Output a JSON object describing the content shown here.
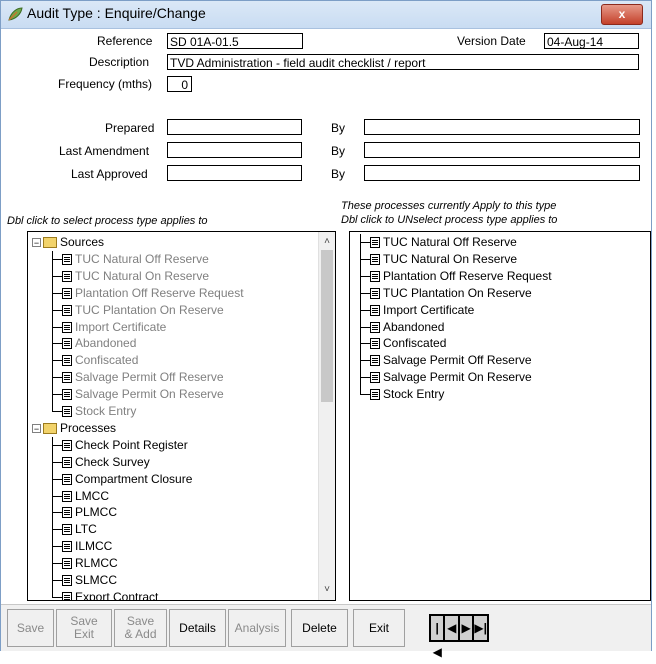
{
  "window": {
    "title": "Audit Type : Enquire/Change",
    "close_label": "x"
  },
  "form": {
    "reference_label": "Reference",
    "reference_value": "SD 01A-01.5",
    "version_date_label": "Version Date",
    "version_date_value": "04-Aug-14",
    "description_label": "Description",
    "description_value": "TVD Administration - field audit checklist / report",
    "frequency_label": "Frequency (mths)",
    "frequency_value": "0",
    "prepared_label": "Prepared",
    "prepared_value": "",
    "last_amendment_label": "Last Amendment",
    "last_amendment_value": "",
    "last_approved_label": "Last Approved",
    "last_approved_value": "",
    "by_label": "By",
    "by_prepared_value": "",
    "by_amendment_value": "",
    "by_approved_value": ""
  },
  "left_panel": {
    "hint": "Dbl click to select process type applies to",
    "groups": [
      {
        "label": "Sources",
        "items": [
          "TUC Natural Off Reserve",
          "TUC Natural On Reserve",
          "Plantation Off Reserve Request",
          "TUC Plantation On Reserve",
          "Import Certificate",
          "Abandoned",
          "Confiscated",
          "Salvage Permit Off Reserve",
          "Salvage Permit On Reserve",
          "Stock Entry"
        ]
      },
      {
        "label": "Processes",
        "items": [
          "Check Point Register",
          "Check Survey",
          "Compartment Closure",
          "LMCC",
          "PLMCC",
          "LTC",
          "ILMCC",
          "RLMCC",
          "SLMCC",
          "Export Contract"
        ]
      }
    ]
  },
  "right_panel": {
    "hint_line1": "These processes currently Apply to this type",
    "hint_line2": "Dbl click to UNselect process type applies to",
    "items": [
      "TUC Natural Off Reserve",
      "TUC Natural On Reserve",
      "Plantation Off Reserve Request",
      "TUC Plantation On Reserve",
      "Import Certificate",
      "Abandoned",
      "Confiscated",
      "Salvage Permit Off Reserve",
      "Salvage Permit On Reserve",
      "Stock Entry"
    ]
  },
  "toolbar": {
    "save": "Save",
    "save_exit_1": "Save",
    "save_exit_2": "Exit",
    "save_add_1": "Save",
    "save_add_2": "& Add",
    "details": "Details",
    "analysis": "Analysis",
    "delete": "Delete",
    "exit": "Exit",
    "nav_first": "|◀",
    "nav_prev": "◀",
    "nav_next": "▶",
    "nav_last": "▶|"
  },
  "colors": {
    "title_bar": "#c9dcf2",
    "close_button": "#c4412a",
    "disabled_text": "#808080"
  }
}
